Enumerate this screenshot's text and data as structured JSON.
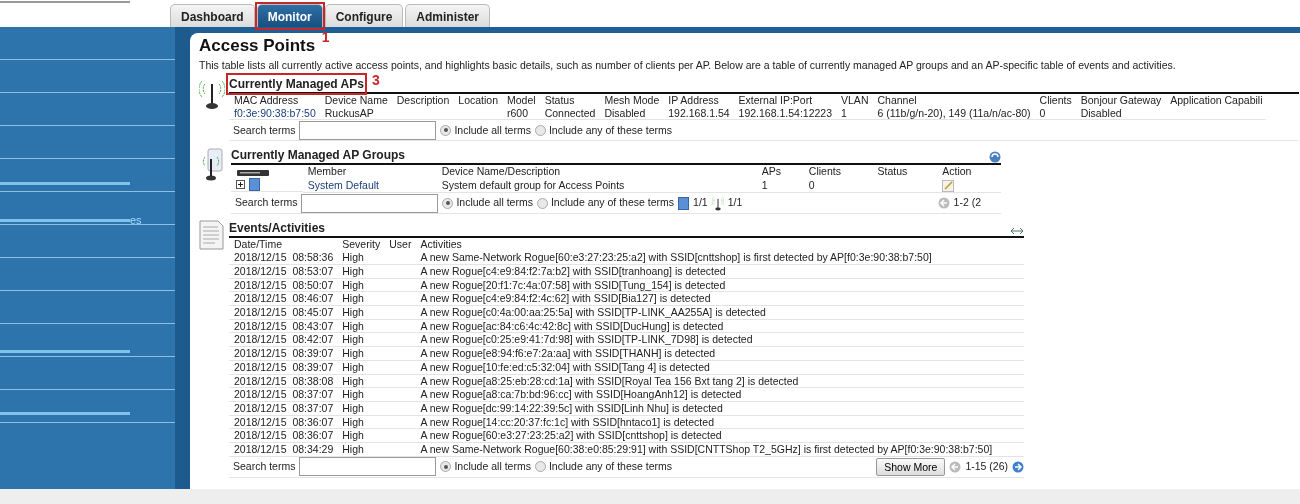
{
  "tabs": [
    {
      "label": "Dashboard",
      "selected": false
    },
    {
      "label": "Monitor",
      "selected": true,
      "callout": "1"
    },
    {
      "label": "Configure",
      "selected": false
    },
    {
      "label": "Administer",
      "selected": false
    }
  ],
  "sidebar": {
    "text": "es"
  },
  "page": {
    "title": "Access Points",
    "description": "This table lists all currently active access points, and highlights basic details, such as number of clients per AP. Below are a table of currently managed AP groups and an AP-specific table of events and activities."
  },
  "managed_aps": {
    "title": "Currently Managed APs",
    "callout": "3",
    "columns": [
      "MAC Address",
      "Device Name",
      "Description",
      "Location",
      "Model",
      "Status",
      "Mesh Mode",
      "IP Address",
      "External IP:Port",
      "VLAN",
      "Channel",
      "Clients",
      "Bonjour Gateway",
      "Application Capabili"
    ],
    "rows": [
      [
        "f0:3e:90:38:b7:50",
        "RuckusAP",
        "",
        "",
        "r600",
        "Connected",
        "Disabled",
        "192.168.1.54",
        "192.168.1.54:12223",
        "1",
        "6 (11b/g/n-20), 149 (11a/n/ac-80)",
        "0",
        "Disabled",
        ""
      ]
    ],
    "search": {
      "label": "Search terms",
      "options": [
        {
          "label": "Include all terms",
          "selected": true
        },
        {
          "label": "Include any of these terms",
          "selected": false
        }
      ]
    }
  },
  "ap_groups": {
    "title": "Currently Managed AP Groups",
    "columns": [
      "Member",
      "Device Name/Description",
      "APs",
      "Clients",
      "Status",
      "Action"
    ],
    "rows": [
      {
        "member": "System Default",
        "description": "System default group for Access Points",
        "aps": "1",
        "clients": "0",
        "status": "",
        "expanded": false
      }
    ],
    "search": {
      "label": "Search terms",
      "options": [
        {
          "label": "Include all terms",
          "selected": true
        },
        {
          "label": "Include any of these terms",
          "selected": false
        }
      ]
    },
    "counts": [
      "1/1",
      "1/1"
    ],
    "pager": "1-2 (2"
  },
  "events": {
    "title": "Events/Activities",
    "columns": [
      "Date/Time",
      "Severity",
      "User",
      "Activities"
    ],
    "rows": [
      [
        "2018/12/15  08:58:36",
        "High",
        "",
        "A new Same-Network Rogue[60:e3:27:23:25:a2] with SSID[cnttshop] is first detected by AP[f0:3e:90:38:b7:50]"
      ],
      [
        "2018/12/15  08:53:07",
        "High",
        "",
        "A new Rogue[c4:e9:84:f2:7a:b2] with SSID[tranhoang] is detected"
      ],
      [
        "2018/12/15  08:50:07",
        "High",
        "",
        "A new Rogue[20:f1:7c:4a:07:58] with SSID[Tung_154] is detected"
      ],
      [
        "2018/12/15  08:46:07",
        "High",
        "",
        "A new Rogue[c4:e9:84:f2:4c:62] with SSID[Bia127] is detected"
      ],
      [
        "2018/12/15  08:45:07",
        "High",
        "",
        "A new Rogue[c0:4a:00:aa:25:5a] with SSID[TP-LINK_AA255A] is detected"
      ],
      [
        "2018/12/15  08:43:07",
        "High",
        "",
        "A new Rogue[ac:84:c6:4c:42:8c] with SSID[DucHung] is detected"
      ],
      [
        "2018/12/15  08:42:07",
        "High",
        "",
        "A new Rogue[c0:25:e9:41:7d:98] with SSID[TP-LINK_7D98] is detected"
      ],
      [
        "2018/12/15  08:39:07",
        "High",
        "",
        "A new Rogue[e8:94:f6:e7:2a:aa] with SSID[THANH] is detected"
      ],
      [
        "2018/12/15  08:39:07",
        "High",
        "",
        "A new Rogue[10:fe:ed:c5:32:04] with SSID[Tang 4] is detected"
      ],
      [
        "2018/12/15  08:38:08",
        "High",
        "",
        "A new Rogue[a8:25:eb:28:cd:1a] with SSID[Royal Tea 156 Bxt tang 2] is detected"
      ],
      [
        "2018/12/15  08:37:07",
        "High",
        "",
        "A new Rogue[a8:ca:7b:bd:96:cc] with SSID[HoangAnh12] is detected"
      ],
      [
        "2018/12/15  08:37:07",
        "High",
        "",
        "A new Rogue[dc:99:14:22:39:5c] with SSID[Linh Nhu] is detected"
      ],
      [
        "2018/12/15  08:36:07",
        "High",
        "",
        "A new Rogue[14:cc:20:37:fc:1c] with SSID[hntaco1] is detected"
      ],
      [
        "2018/12/15  08:36:07",
        "High",
        "",
        "A new Rogue[60:e3:27:23:25:a2] with SSID[cnttshop] is detected"
      ],
      [
        "2018/12/15  08:34:29",
        "High",
        "",
        "A new Same-Network Rogue[60:38:e0:85:29:91] with SSID[CNTTShop T2_5GHz] is first detected by AP[f0:3e:90:38:b7:50]"
      ]
    ],
    "search": {
      "label": "Search terms",
      "options": [
        {
          "label": "Include all terms",
          "selected": true
        },
        {
          "label": "Include any of these terms",
          "selected": false
        }
      ]
    },
    "button": "Show More",
    "pager": "1-15 (26)"
  }
}
